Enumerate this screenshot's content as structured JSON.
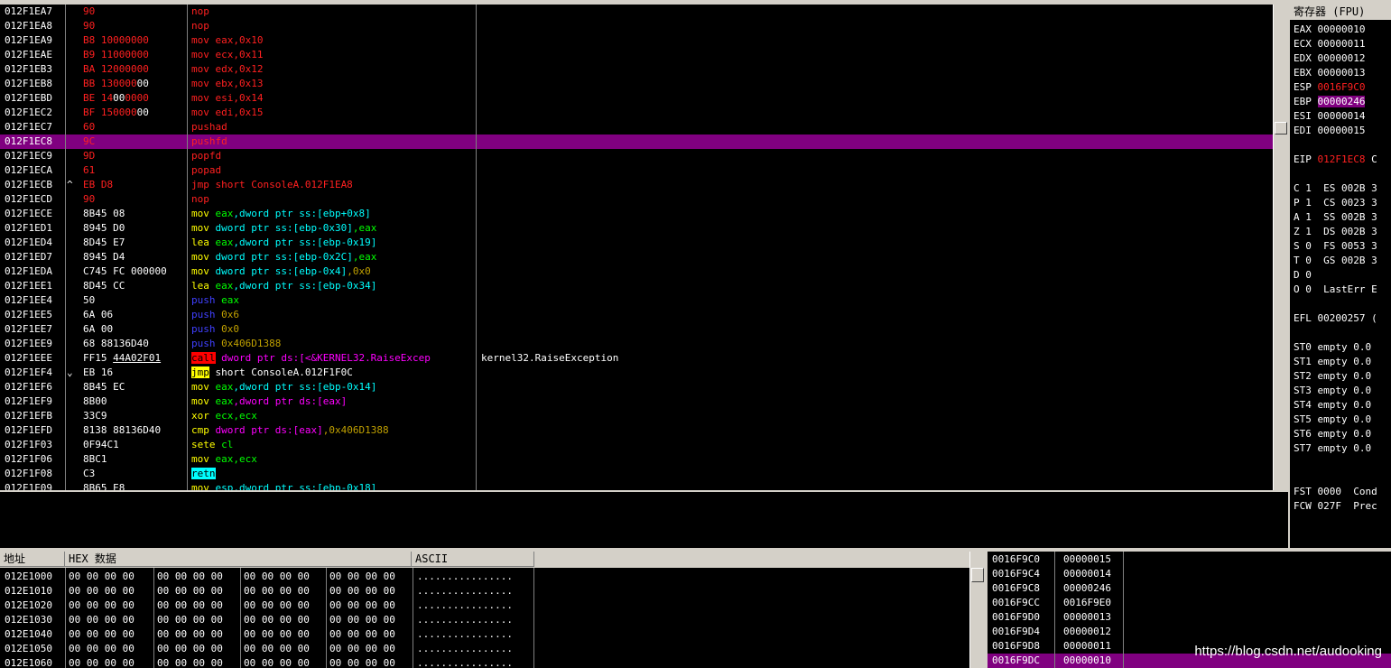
{
  "disasm": {
    "highlight_index": 9,
    "rows": [
      {
        "addr": "012F1EA7",
        "mark": "",
        "hex": [
          {
            "t": "90",
            "c": "#ff2020"
          }
        ],
        "asm": [
          {
            "t": "nop",
            "c": "#ff2020"
          }
        ],
        "cmt": ""
      },
      {
        "addr": "012F1EA8",
        "mark": "",
        "hex": [
          {
            "t": "90",
            "c": "#ff2020"
          }
        ],
        "asm": [
          {
            "t": "nop",
            "c": "#ff2020"
          }
        ],
        "cmt": ""
      },
      {
        "addr": "012F1EA9",
        "mark": "",
        "hex": [
          {
            "t": "B8 10000000",
            "c": "#ff2020"
          }
        ],
        "asm": [
          {
            "t": "mov eax,0x10",
            "c": "#ff2020"
          }
        ],
        "cmt": ""
      },
      {
        "addr": "012F1EAE",
        "mark": "",
        "hex": [
          {
            "t": "B9 11000000",
            "c": "#ff2020"
          }
        ],
        "asm": [
          {
            "t": "mov ecx,0x11",
            "c": "#ff2020"
          }
        ],
        "cmt": ""
      },
      {
        "addr": "012F1EB3",
        "mark": "",
        "hex": [
          {
            "t": "BA 12000000",
            "c": "#ff2020"
          }
        ],
        "asm": [
          {
            "t": "mov edx,0x12",
            "c": "#ff2020"
          }
        ],
        "cmt": ""
      },
      {
        "addr": "012F1EB8",
        "mark": "",
        "hex": [
          {
            "t": "BB 130000",
            "c": "#ff2020"
          },
          {
            "t": "00",
            "c": "#ffffff"
          }
        ],
        "asm": [
          {
            "t": "mov ebx,0x13",
            "c": "#ff2020"
          }
        ],
        "cmt": ""
      },
      {
        "addr": "012F1EBD",
        "mark": "",
        "hex": [
          {
            "t": "BE 14",
            "c": "#ff2020"
          },
          {
            "t": "00",
            "c": "#ffffff"
          },
          {
            "t": "0000",
            "c": "#ff2020"
          }
        ],
        "asm": [
          {
            "t": "mov esi,0x14",
            "c": "#ff2020"
          }
        ],
        "cmt": ""
      },
      {
        "addr": "012F1EC2",
        "mark": "",
        "hex": [
          {
            "t": "BF 150000",
            "c": "#ff2020"
          },
          {
            "t": "00",
            "c": "#ffffff"
          }
        ],
        "asm": [
          {
            "t": "mov edi,0x15",
            "c": "#ff2020"
          }
        ],
        "cmt": ""
      },
      {
        "addr": "012F1EC7",
        "mark": "",
        "hex": [
          {
            "t": "60",
            "c": "#ff2020"
          }
        ],
        "asm": [
          {
            "t": "pushad",
            "c": "#ff2020"
          }
        ],
        "cmt": ""
      },
      {
        "addr": "012F1EC8",
        "mark": "",
        "hex": [
          {
            "t": "9C",
            "c": "#ff2020"
          }
        ],
        "asm": [
          {
            "t": "pushfd",
            "c": "#ff2020"
          }
        ],
        "cmt": ""
      },
      {
        "addr": "012F1EC9",
        "mark": "",
        "hex": [
          {
            "t": "9D",
            "c": "#ff2020"
          }
        ],
        "asm": [
          {
            "t": "popfd",
            "c": "#ff2020"
          }
        ],
        "cmt": ""
      },
      {
        "addr": "012F1ECA",
        "mark": "",
        "hex": [
          {
            "t": "61",
            "c": "#ff2020"
          }
        ],
        "asm": [
          {
            "t": "popad",
            "c": "#ff2020"
          }
        ],
        "cmt": ""
      },
      {
        "addr": "012F1ECB",
        "mark": "^",
        "hex": [
          {
            "t": "EB D8",
            "c": "#ff2020"
          }
        ],
        "asm": [
          {
            "t": "jmp short ConsoleA.012F1EA8",
            "c": "#ff2020"
          }
        ],
        "cmt": ""
      },
      {
        "addr": "012F1ECD",
        "mark": "",
        "hex": [
          {
            "t": "90",
            "c": "#ff2020"
          }
        ],
        "asm": [
          {
            "t": "nop",
            "c": "#ff2020"
          }
        ],
        "cmt": ""
      },
      {
        "addr": "012F1ECE",
        "mark": "",
        "hex": [
          {
            "t": "8B45 08",
            "c": "#ffffff"
          }
        ],
        "asm": [
          {
            "t": "mov ",
            "c": "#ffff00"
          },
          {
            "t": "eax",
            "c": "#00ff00"
          },
          {
            "t": ",dword ptr ss:[ebp+0x8]",
            "c": "#00ffff"
          }
        ],
        "cmt": ""
      },
      {
        "addr": "012F1ED1",
        "mark": "",
        "hex": [
          {
            "t": "8945 D0",
            "c": "#ffffff"
          }
        ],
        "asm": [
          {
            "t": "mov ",
            "c": "#ffff00"
          },
          {
            "t": "dword ptr ss:[ebp-0x30]",
            "c": "#00ffff"
          },
          {
            "t": ",eax",
            "c": "#00ff00"
          }
        ],
        "cmt": ""
      },
      {
        "addr": "012F1ED4",
        "mark": "",
        "hex": [
          {
            "t": "8D45 E7",
            "c": "#ffffff"
          }
        ],
        "asm": [
          {
            "t": "lea ",
            "c": "#ffff00"
          },
          {
            "t": "eax",
            "c": "#00ff00"
          },
          {
            "t": ",dword ptr ss:[ebp-0x19]",
            "c": "#00ffff"
          }
        ],
        "cmt": ""
      },
      {
        "addr": "012F1ED7",
        "mark": "",
        "hex": [
          {
            "t": "8945 D4",
            "c": "#ffffff"
          }
        ],
        "asm": [
          {
            "t": "mov ",
            "c": "#ffff00"
          },
          {
            "t": "dword ptr ss:[ebp-0x2C]",
            "c": "#00ffff"
          },
          {
            "t": ",eax",
            "c": "#00ff00"
          }
        ],
        "cmt": ""
      },
      {
        "addr": "012F1EDA",
        "mark": "",
        "hex": [
          {
            "t": "C745 FC 000000",
            "c": "#ffffff"
          }
        ],
        "asm": [
          {
            "t": "mov ",
            "c": "#ffff00"
          },
          {
            "t": "dword ptr ss:[ebp-0x4]",
            "c": "#00ffff"
          },
          {
            "t": ",0x0",
            "c": "#c0a000"
          }
        ],
        "cmt": ""
      },
      {
        "addr": "012F1EE1",
        "mark": "",
        "hex": [
          {
            "t": "8D45 CC",
            "c": "#ffffff"
          }
        ],
        "asm": [
          {
            "t": "lea ",
            "c": "#ffff00"
          },
          {
            "t": "eax",
            "c": "#00ff00"
          },
          {
            "t": ",dword ptr ss:[ebp-0x34]",
            "c": "#00ffff"
          }
        ],
        "cmt": ""
      },
      {
        "addr": "012F1EE4",
        "mark": "",
        "hex": [
          {
            "t": "50",
            "c": "#ffffff"
          }
        ],
        "asm": [
          {
            "t": "push ",
            "c": "#4040ff"
          },
          {
            "t": "eax",
            "c": "#00ff00"
          }
        ],
        "cmt": ""
      },
      {
        "addr": "012F1EE5",
        "mark": "",
        "hex": [
          {
            "t": "6A 06",
            "c": "#ffffff"
          }
        ],
        "asm": [
          {
            "t": "push ",
            "c": "#4040ff"
          },
          {
            "t": "0x6",
            "c": "#c0a000"
          }
        ],
        "cmt": ""
      },
      {
        "addr": "012F1EE7",
        "mark": "",
        "hex": [
          {
            "t": "6A 00",
            "c": "#ffffff"
          }
        ],
        "asm": [
          {
            "t": "push ",
            "c": "#4040ff"
          },
          {
            "t": "0x0",
            "c": "#c0a000"
          }
        ],
        "cmt": ""
      },
      {
        "addr": "012F1EE9",
        "mark": "",
        "hex": [
          {
            "t": "68 88136D40",
            "c": "#ffffff"
          }
        ],
        "asm": [
          {
            "t": "push ",
            "c": "#4040ff"
          },
          {
            "t": "0x406D1388",
            "c": "#c0a000"
          }
        ],
        "cmt": ""
      },
      {
        "addr": "012F1EEE",
        "mark": "",
        "hex": [
          {
            "t": "FF15 ",
            "c": "#ffffff"
          },
          {
            "t": "44A02F01",
            "c": "#ffffff",
            "u": true
          }
        ],
        "asm": [
          {
            "t": "call",
            "c": "#000000",
            "bg": "#ff0000"
          },
          {
            "t": " dword ptr ds:[<&KERNEL32.RaiseExcep",
            "c": "#ff00ff"
          }
        ],
        "cmt": "kernel32.RaiseException"
      },
      {
        "addr": "012F1EF4",
        "mark": "v",
        "hex": [
          {
            "t": "EB 16",
            "c": "#ffffff"
          }
        ],
        "asm": [
          {
            "t": "jmp",
            "c": "#000000",
            "bg": "#ffff00"
          },
          {
            "t": " short ConsoleA.012F1F0C",
            "c": "#ffffff"
          }
        ],
        "cmt": ""
      },
      {
        "addr": "012F1EF6",
        "mark": "",
        "hex": [
          {
            "t": "8B45 EC",
            "c": "#ffffff"
          }
        ],
        "asm": [
          {
            "t": "mov ",
            "c": "#ffff00"
          },
          {
            "t": "eax",
            "c": "#00ff00"
          },
          {
            "t": ",dword ptr ss:[ebp-0x14]",
            "c": "#00ffff"
          }
        ],
        "cmt": ""
      },
      {
        "addr": "012F1EF9",
        "mark": "",
        "hex": [
          {
            "t": "8B00",
            "c": "#ffffff"
          }
        ],
        "asm": [
          {
            "t": "mov ",
            "c": "#ffff00"
          },
          {
            "t": "eax",
            "c": "#00ff00"
          },
          {
            "t": ",dword ptr ds:[eax]",
            "c": "#ff00ff"
          }
        ],
        "cmt": ""
      },
      {
        "addr": "012F1EFB",
        "mark": "",
        "hex": [
          {
            "t": "33C9",
            "c": "#ffffff"
          }
        ],
        "asm": [
          {
            "t": "xor ",
            "c": "#ffff00"
          },
          {
            "t": "ecx,ecx",
            "c": "#00ff00"
          }
        ],
        "cmt": ""
      },
      {
        "addr": "012F1EFD",
        "mark": "",
        "hex": [
          {
            "t": "8138 88136D40",
            "c": "#ffffff"
          }
        ],
        "asm": [
          {
            "t": "cmp ",
            "c": "#ffff00"
          },
          {
            "t": "dword ptr ds:[eax]",
            "c": "#ff00ff"
          },
          {
            "t": ",0x406D1388",
            "c": "#c0a000"
          }
        ],
        "cmt": ""
      },
      {
        "addr": "012F1F03",
        "mark": "",
        "hex": [
          {
            "t": "0F94C1",
            "c": "#ffffff"
          }
        ],
        "asm": [
          {
            "t": "sete ",
            "c": "#ffff00"
          },
          {
            "t": "cl",
            "c": "#00ff00"
          }
        ],
        "cmt": ""
      },
      {
        "addr": "012F1F06",
        "mark": "",
        "hex": [
          {
            "t": "8BC1",
            "c": "#ffffff"
          }
        ],
        "asm": [
          {
            "t": "mov ",
            "c": "#ffff00"
          },
          {
            "t": "eax,ecx",
            "c": "#00ff00"
          }
        ],
        "cmt": ""
      },
      {
        "addr": "012F1F08",
        "mark": "",
        "hex": [
          {
            "t": "C3",
            "c": "#ffffff"
          }
        ],
        "asm": [
          {
            "t": "retn",
            "c": "#000000",
            "bg": "#00ffff"
          }
        ],
        "cmt": ""
      },
      {
        "addr": "012F1F09",
        "mark": "",
        "hex": [
          {
            "t": "8B65 E8",
            "c": "#ffffff"
          }
        ],
        "asm": [
          {
            "t": "mov ",
            "c": "#ffff00"
          },
          {
            "t": "esp,dword ptr ss:[ebp-0x18]",
            "c": "#00ffff"
          }
        ],
        "cmt": ""
      }
    ]
  },
  "registers": {
    "title": "寄存器 (FPU)",
    "lines": [
      [
        {
          "t": "EAX 00000010",
          "c": "#ffffff"
        }
      ],
      [
        {
          "t": "ECX 00000011",
          "c": "#ffffff"
        }
      ],
      [
        {
          "t": "EDX 00000012",
          "c": "#ffffff"
        }
      ],
      [
        {
          "t": "EBX 00000013",
          "c": "#ffffff"
        }
      ],
      [
        {
          "t": "ESP ",
          "c": "#ffffff"
        },
        {
          "t": "0016F9C0",
          "c": "#ff2020"
        }
      ],
      [
        {
          "t": "EBP ",
          "c": "#ffffff"
        },
        {
          "t": "00000246",
          "c": "#ffffff",
          "bg": "#800080"
        }
      ],
      [
        {
          "t": "ESI 00000014",
          "c": "#ffffff"
        }
      ],
      [
        {
          "t": "EDI 00000015",
          "c": "#ffffff"
        }
      ],
      [
        {
          "t": "",
          "c": "#ffffff"
        }
      ],
      [
        {
          "t": "EIP ",
          "c": "#ffffff"
        },
        {
          "t": "012F1EC8",
          "c": "#ff2020"
        },
        {
          "t": " C",
          "c": "#ffffff"
        }
      ],
      [
        {
          "t": "",
          "c": "#ffffff"
        }
      ],
      [
        {
          "t": "C 1  ES 002B 3",
          "c": "#ffffff"
        }
      ],
      [
        {
          "t": "P 1  CS 0023 3",
          "c": "#ffffff"
        }
      ],
      [
        {
          "t": "A 1  SS 002B 3",
          "c": "#ffffff"
        }
      ],
      [
        {
          "t": "Z 1  DS 002B 3",
          "c": "#ffffff"
        }
      ],
      [
        {
          "t": "S 0  FS 0053 3",
          "c": "#ffffff"
        }
      ],
      [
        {
          "t": "T 0  GS 002B 3",
          "c": "#ffffff"
        }
      ],
      [
        {
          "t": "D 0",
          "c": "#ffffff"
        }
      ],
      [
        {
          "t": "O 0  LastErr E",
          "c": "#ffffff"
        }
      ],
      [
        {
          "t": "",
          "c": "#ffffff"
        }
      ],
      [
        {
          "t": "EFL 00200257 (",
          "c": "#ffffff"
        }
      ],
      [
        {
          "t": "",
          "c": "#ffffff"
        }
      ],
      [
        {
          "t": "ST0 empty 0.0",
          "c": "#ffffff"
        }
      ],
      [
        {
          "t": "ST1 empty 0.0",
          "c": "#ffffff"
        }
      ],
      [
        {
          "t": "ST2 empty 0.0",
          "c": "#ffffff"
        }
      ],
      [
        {
          "t": "ST3 empty 0.0",
          "c": "#ffffff"
        }
      ],
      [
        {
          "t": "ST4 empty 0.0",
          "c": "#ffffff"
        }
      ],
      [
        {
          "t": "ST5 empty 0.0",
          "c": "#ffffff"
        }
      ],
      [
        {
          "t": "ST6 empty 0.0",
          "c": "#ffffff"
        }
      ],
      [
        {
          "t": "ST7 empty 0.0",
          "c": "#ffffff"
        }
      ],
      [
        {
          "t": "",
          "c": "#ffffff"
        }
      ],
      [
        {
          "t": "",
          "c": "#ffffff"
        }
      ],
      [
        {
          "t": "FST 0000  Cond",
          "c": "#ffffff"
        }
      ],
      [
        {
          "t": "FCW 027F  Prec",
          "c": "#ffffff"
        }
      ]
    ]
  },
  "dump": {
    "headers": {
      "addr": "地址",
      "hex": "HEX 数据",
      "ascii": "ASCII"
    },
    "rows": [
      {
        "addr": "012E1000",
        "hex": [
          "00 00 00 00",
          "00 00 00 00",
          "00 00 00 00",
          "00 00 00 00"
        ],
        "ascii": "................"
      },
      {
        "addr": "012E1010",
        "hex": [
          "00 00 00 00",
          "00 00 00 00",
          "00 00 00 00",
          "00 00 00 00"
        ],
        "ascii": "................"
      },
      {
        "addr": "012E1020",
        "hex": [
          "00 00 00 00",
          "00 00 00 00",
          "00 00 00 00",
          "00 00 00 00"
        ],
        "ascii": "................"
      },
      {
        "addr": "012E1030",
        "hex": [
          "00 00 00 00",
          "00 00 00 00",
          "00 00 00 00",
          "00 00 00 00"
        ],
        "ascii": "................"
      },
      {
        "addr": "012E1040",
        "hex": [
          "00 00 00 00",
          "00 00 00 00",
          "00 00 00 00",
          "00 00 00 00"
        ],
        "ascii": "................"
      },
      {
        "addr": "012E1050",
        "hex": [
          "00 00 00 00",
          "00 00 00 00",
          "00 00 00 00",
          "00 00 00 00"
        ],
        "ascii": "................"
      },
      {
        "addr": "012E1060",
        "hex": [
          "00 00 00 00",
          "00 00 00 00",
          "00 00 00 00",
          "00 00 00 00"
        ],
        "ascii": "................"
      }
    ]
  },
  "stack": {
    "highlight_index": 7,
    "rows": [
      {
        "addr": "0016F9C0",
        "val": "00000015"
      },
      {
        "addr": "0016F9C4",
        "val": "00000014"
      },
      {
        "addr": "0016F9C8",
        "val": "00000246"
      },
      {
        "addr": "0016F9CC",
        "val": "0016F9E0"
      },
      {
        "addr": "0016F9D0",
        "val": "00000013"
      },
      {
        "addr": "0016F9D4",
        "val": "00000012"
      },
      {
        "addr": "0016F9D8",
        "val": "00000011"
      },
      {
        "addr": "0016F9DC",
        "val": "00000010"
      }
    ]
  },
  "watermark": "https://blog.csdn.net/audooking"
}
